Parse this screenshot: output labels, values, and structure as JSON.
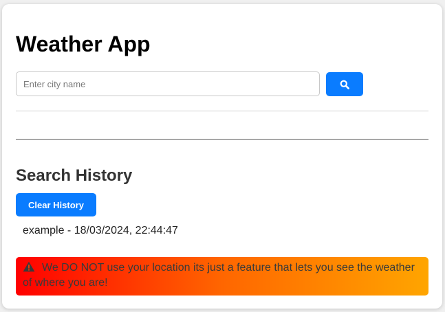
{
  "app": {
    "title": "Weather App"
  },
  "search": {
    "placeholder": "Enter city name",
    "value": "",
    "button_icon": "search-icon"
  },
  "history": {
    "title": "Search History",
    "clear_label": "Clear History",
    "items": [
      {
        "text": "example - 18/03/2024, 22:44:47"
      }
    ]
  },
  "notice": {
    "icon": "warning-icon",
    "text": "We DO NOT use your location its just a feature that lets you see the weather of where you are!"
  },
  "colors": {
    "accent": "#0a7cff",
    "notice_gradient_start": "#ff0000",
    "notice_gradient_end": "#ffa500"
  }
}
